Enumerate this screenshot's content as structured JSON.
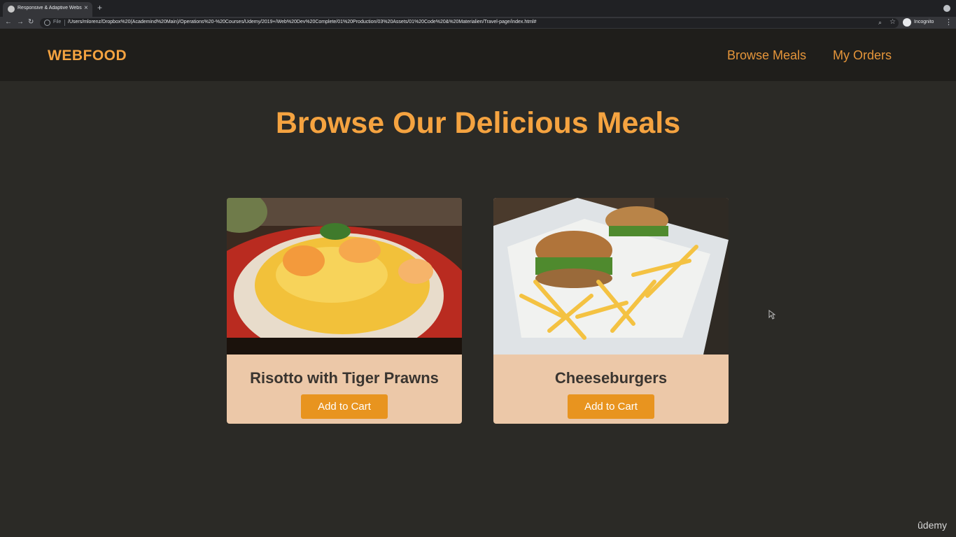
{
  "browser": {
    "tab_title": "Responsive & Adaptive Websit",
    "new_tab_symbol": "+",
    "tab_close_symbol": "×",
    "file_label": "File",
    "url": "/Users/mlorenz/Dropbox%20(Academind%20Main)/Operations%20-%20Courses/Udemy/2019+/Web%20Dev%20Complete/01%20Production/03%20Assets/01%20Code%20&%20Materialien/Travel-page/index.html#",
    "incognito_label": "Incognito",
    "icons": [
      "back-arrow-icon",
      "forward-arrow-icon",
      "reload-icon",
      "info-icon",
      "zoom-icon",
      "star-icon",
      "incognito-icon",
      "menu-icon"
    ]
  },
  "site": {
    "brand": "WEBFOOD",
    "nav": [
      "Browse Meals",
      "My Orders"
    ],
    "title": "Browse Our Delicious Meals"
  },
  "meals": [
    {
      "name": "Risotto with Tiger Prawns",
      "button": "Add to Cart"
    },
    {
      "name": "Cheeseburgers",
      "button": "Add to Cart"
    }
  ],
  "colors": {
    "accent": "#f5a340",
    "button": "#e8941f",
    "card_background": "#ecc8a8",
    "page_background": "#2b2a26",
    "header_background": "#1f1e1b"
  },
  "watermark": "ûdemy"
}
